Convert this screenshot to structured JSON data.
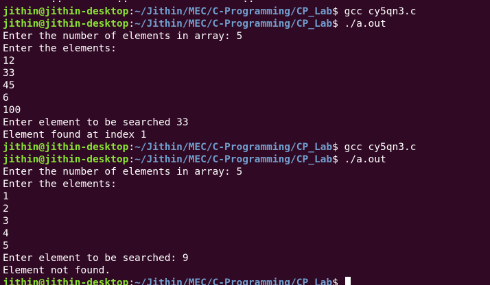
{
  "terminal": {
    "prompt_user": "jithin@jithin-desktop",
    "prompt_path": "~/Jithin/MEC/C-Programming/CP_Lab",
    "prompt_symbol": "$ ",
    "partial_top_line": "        ..         ..                   ..",
    "lines": [
      {
        "type": "prompt",
        "command": "gcc cy5qn3.c"
      },
      {
        "type": "prompt",
        "command": "./a.out"
      },
      {
        "type": "output",
        "text": "Enter the number of elements in array: 5"
      },
      {
        "type": "output",
        "text": "Enter the elements:"
      },
      {
        "type": "output",
        "text": "12"
      },
      {
        "type": "output",
        "text": "33"
      },
      {
        "type": "output",
        "text": "45"
      },
      {
        "type": "output",
        "text": "6"
      },
      {
        "type": "output",
        "text": "100"
      },
      {
        "type": "output",
        "text": "Enter element to be searched 33"
      },
      {
        "type": "output",
        "text": "Element found at index 1"
      },
      {
        "type": "prompt",
        "command": "gcc cy5qn3.c"
      },
      {
        "type": "prompt",
        "command": "./a.out"
      },
      {
        "type": "output",
        "text": "Enter the number of elements in array: 5"
      },
      {
        "type": "output",
        "text": "Enter the elements:"
      },
      {
        "type": "output",
        "text": "1"
      },
      {
        "type": "output",
        "text": "2"
      },
      {
        "type": "output",
        "text": "3"
      },
      {
        "type": "output",
        "text": "4"
      },
      {
        "type": "output",
        "text": "5"
      },
      {
        "type": "output",
        "text": "Enter element to be searched: 9"
      },
      {
        "type": "output",
        "text": "Element not found."
      },
      {
        "type": "prompt",
        "command": "",
        "cursor": true
      }
    ]
  }
}
